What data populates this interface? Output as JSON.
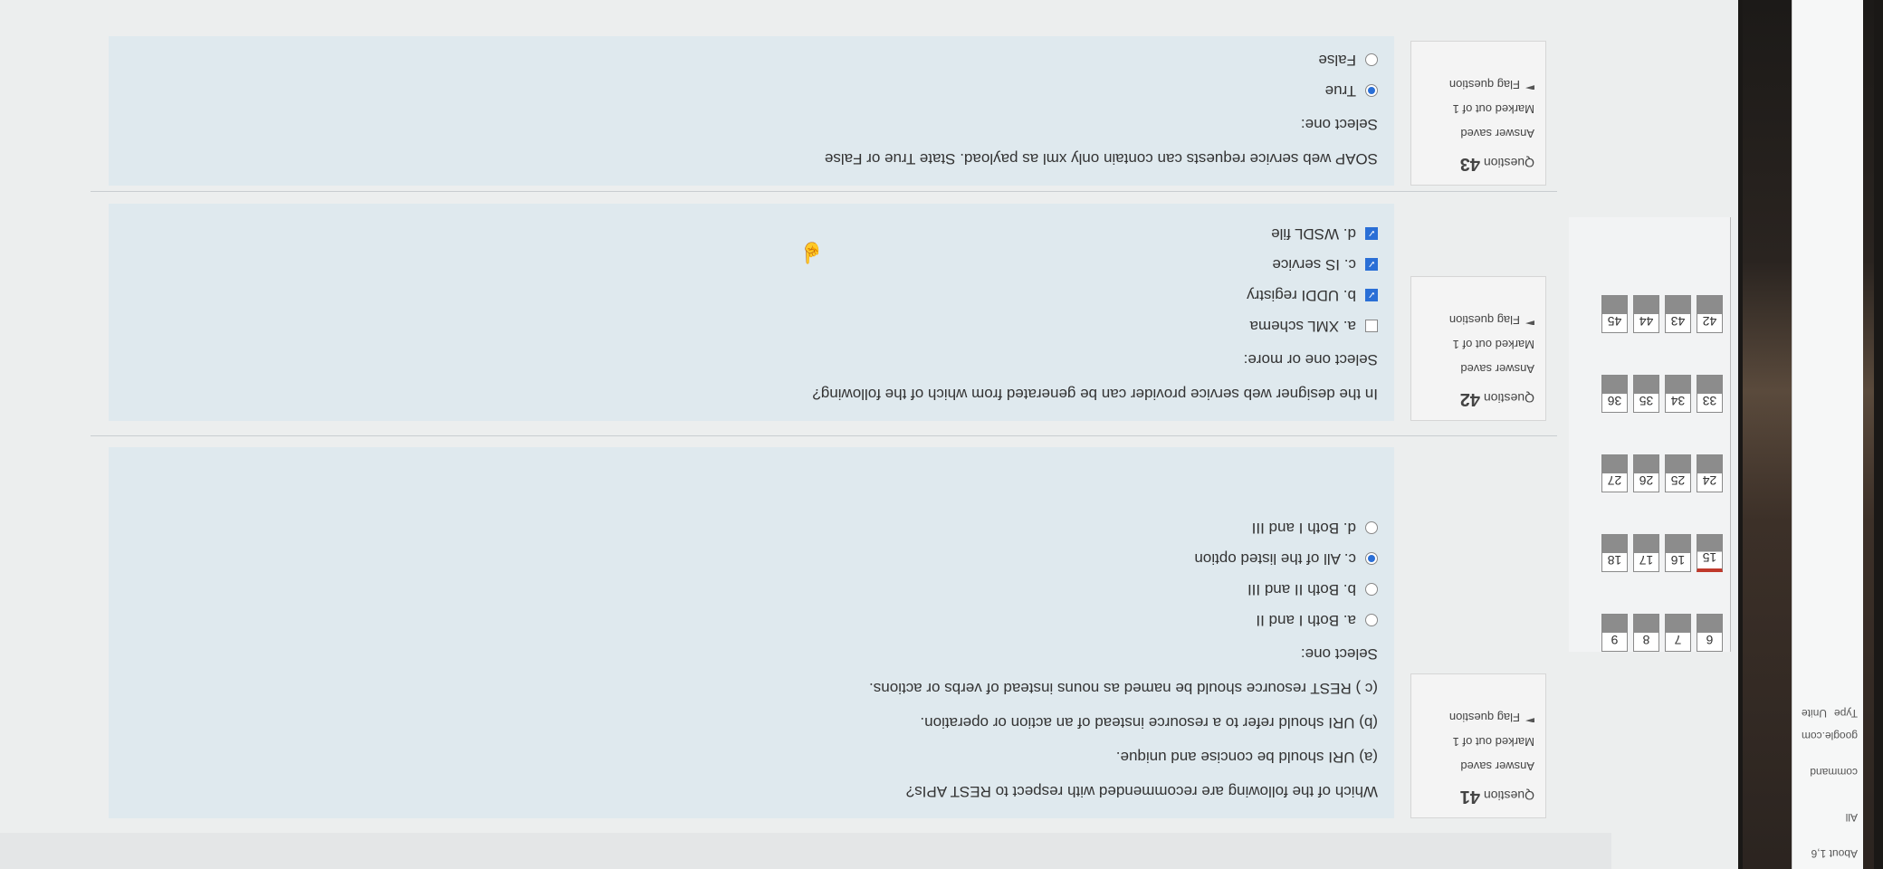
{
  "browser": {
    "chips": [
      "google.com",
      "Type",
      "Unite",
      "command",
      "All",
      "About 1,6"
    ]
  },
  "quiz_nav": {
    "rows": [
      [
        "6",
        "7",
        "8",
        "9"
      ],
      [
        "15",
        "16",
        "17",
        "18"
      ],
      [
        "24",
        "25",
        "26",
        "27"
      ],
      [
        "33",
        "34",
        "35",
        "36"
      ],
      [
        "42",
        "43",
        "44",
        "45"
      ]
    ]
  },
  "questions": [
    {
      "label": "Question",
      "number": "41",
      "status": "Answer saved",
      "mark": "Marked out of 1",
      "flag": "Flag question",
      "text": "Which of the following are recommended with respect to REST APIs?",
      "lines": [
        "(a) URI should be concise and unique.",
        "(b) URI should refer to a resource instead of an action or operation.",
        "(c ) REST resource should be named as nouns instead of verbs or actions."
      ],
      "prompt": "Select one:",
      "options": [
        {
          "text": "a. Both I and II",
          "selected": false
        },
        {
          "text": "b. Both II and III",
          "selected": false
        },
        {
          "text": "c. All of the listed option",
          "selected": true
        },
        {
          "text": "d. Both I and III",
          "selected": false
        }
      ]
    },
    {
      "label": "Question",
      "number": "42",
      "status": "Answer saved",
      "mark": "Marked out of 1",
      "flag": "Flag question",
      "text": "In the designer web service provider can be generated from which of the following?",
      "prompt": "Select one or more:",
      "options": [
        {
          "text": "a. XML schema",
          "selected": false
        },
        {
          "text": "b. UDDI registry",
          "selected": true
        },
        {
          "text": "c. IS service",
          "selected": true
        },
        {
          "text": "d. WSDL file",
          "selected": true
        }
      ]
    },
    {
      "label": "Question",
      "number": "43",
      "status": "Answer saved",
      "mark": "Marked out of 1",
      "flag": "Flag question",
      "text": "SOAP web service requests can contain only xml as payload. State True or False",
      "prompt": "Select one:",
      "options": [
        {
          "text": "True",
          "selected": true
        },
        {
          "text": "False",
          "selected": false
        }
      ]
    }
  ],
  "colors": {
    "content_bg": "#dfe9ee",
    "accent": "#2a6fd6",
    "flag_red": "#c0392b"
  }
}
